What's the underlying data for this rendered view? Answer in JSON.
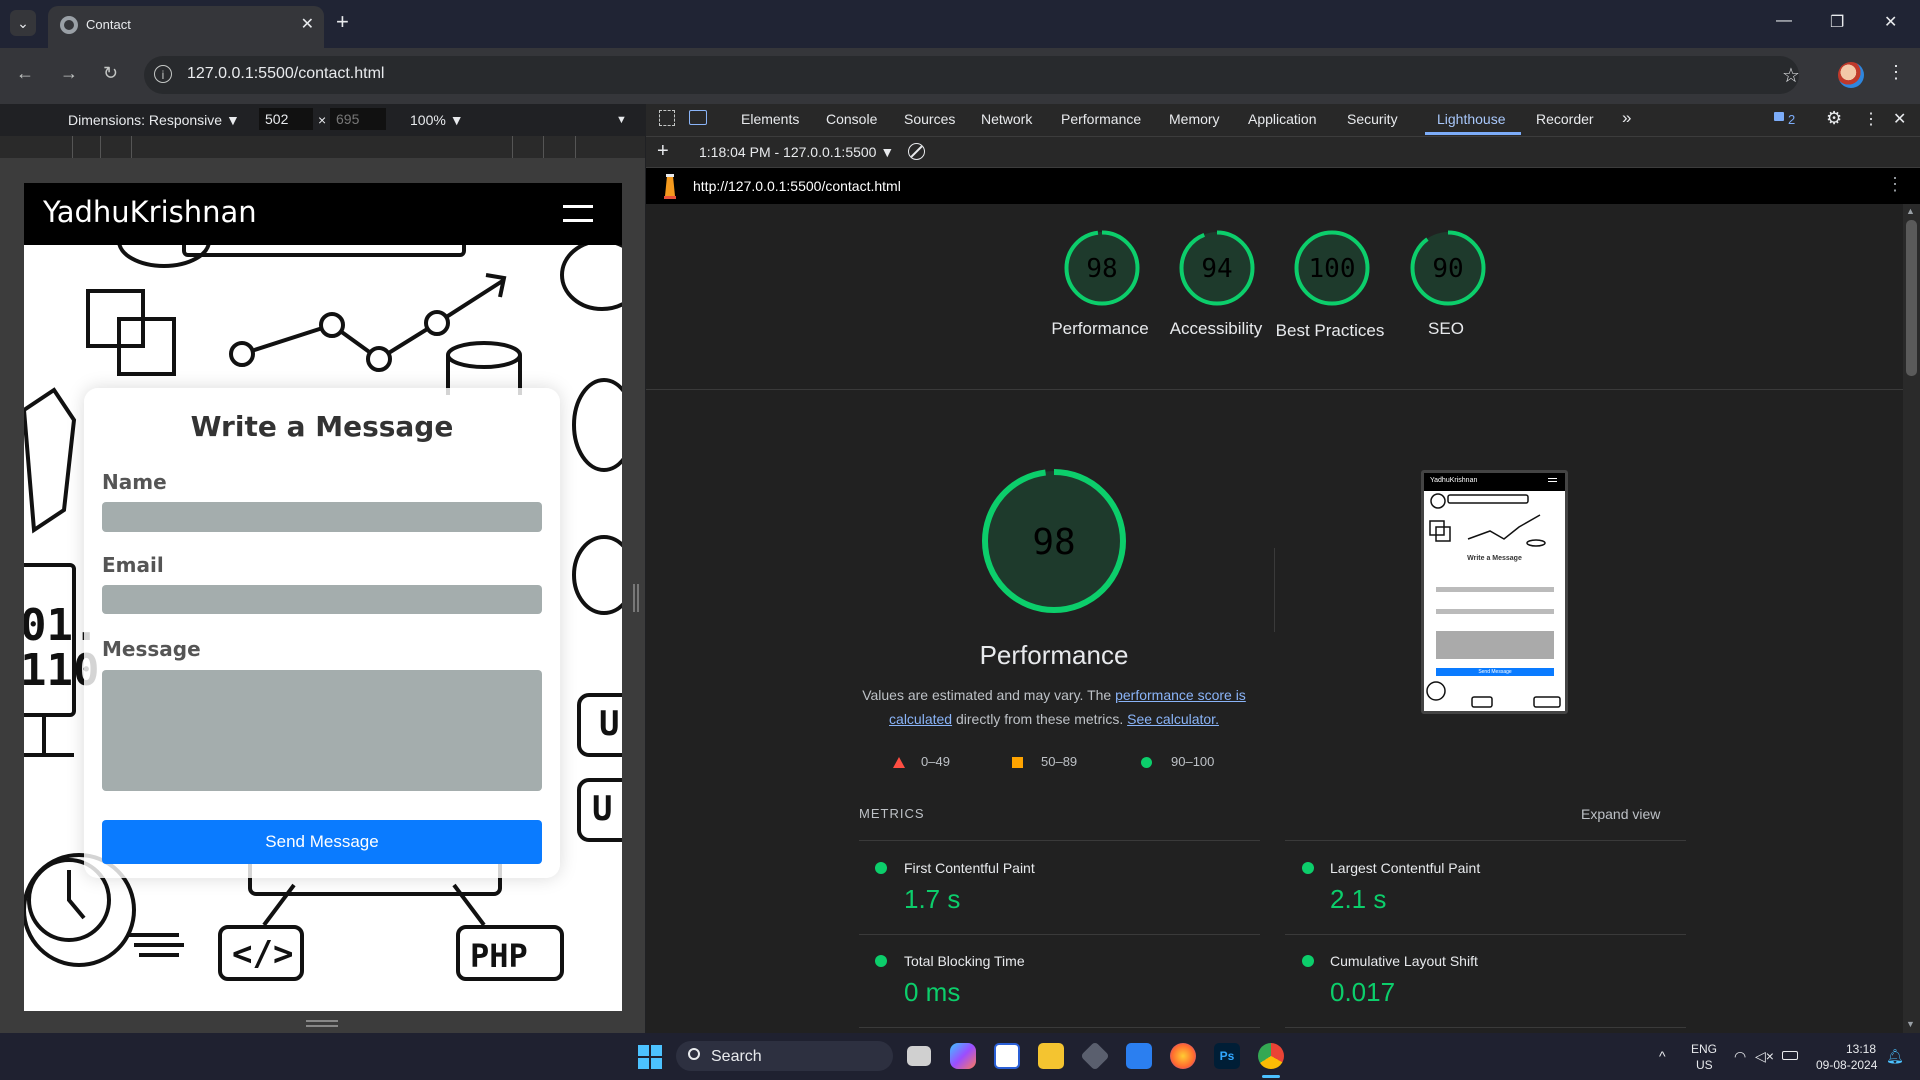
{
  "browser": {
    "tab_title": "Contact",
    "url": "127.0.0.1:5500/contact.html",
    "new_tab": "+",
    "tab_close": "✕",
    "win_min": "—",
    "win_restore": "❐",
    "win_close": "✕"
  },
  "device_toolbar": {
    "dimensions_label": "Dimensions: Responsive ▼",
    "width": "502",
    "times": "×",
    "height": "695",
    "zoom": "100% ▼",
    "more": "▼"
  },
  "page": {
    "brand": "YadhuKrishnan",
    "form_title": "Write a Message",
    "name_label": "Name",
    "email_label": "Email",
    "message_label": "Message",
    "send_button": "Send Message"
  },
  "devtools": {
    "tabs": [
      "Elements",
      "Console",
      "Sources",
      "Network",
      "Performance",
      "Memory",
      "Application",
      "Security",
      "Lighthouse",
      "Recorder"
    ],
    "active_tab": "Lighthouse",
    "more_tabs": "»",
    "issues_count": "2",
    "report_selector": "1:18:04 PM - 127.0.0.1:5500 ▼",
    "report_url": "http://127.0.0.1:5500/contact.html"
  },
  "lighthouse": {
    "scores": [
      {
        "label": "Performance",
        "score": "98",
        "value": 98
      },
      {
        "label": "Accessibility",
        "score": "94",
        "value": 94
      },
      {
        "label": "Best Practices",
        "score": "100",
        "value": 100
      },
      {
        "label": "SEO",
        "score": "90",
        "value": 90
      }
    ],
    "main_score": "98",
    "main_label": "Performance",
    "desc_1": "Values are estimated and may vary. The ",
    "desc_link_1": "performance score is calculated",
    "desc_2": " directly from these metrics. ",
    "desc_link_2": "See calculator.",
    "legend": [
      {
        "range": "0–49",
        "color": "#ff4e42"
      },
      {
        "range": "50–89",
        "color": "#ffa400"
      },
      {
        "range": "90–100",
        "color": "#0cce6b"
      }
    ],
    "metrics_title": "METRICS",
    "expand_view": "Expand view",
    "metrics": [
      {
        "name": "First Contentful Paint",
        "value": "1.7 s"
      },
      {
        "name": "Largest Contentful Paint",
        "value": "2.1 s"
      },
      {
        "name": "Total Blocking Time",
        "value": "0 ms"
      },
      {
        "name": "Cumulative Layout Shift",
        "value": "0.017"
      }
    ],
    "thumb_brand": "YadhuKrishnan",
    "thumb_title": "Write a Message",
    "thumb_button": "Send Message"
  },
  "taskbar": {
    "search": "Search",
    "lang_1": "ENG",
    "lang_2": "US",
    "time": "13:18",
    "date": "09-08-2024"
  },
  "colors": {
    "good": "#0cce6b",
    "accent_button": "#0a7bff",
    "link": "#8ab4f8"
  }
}
